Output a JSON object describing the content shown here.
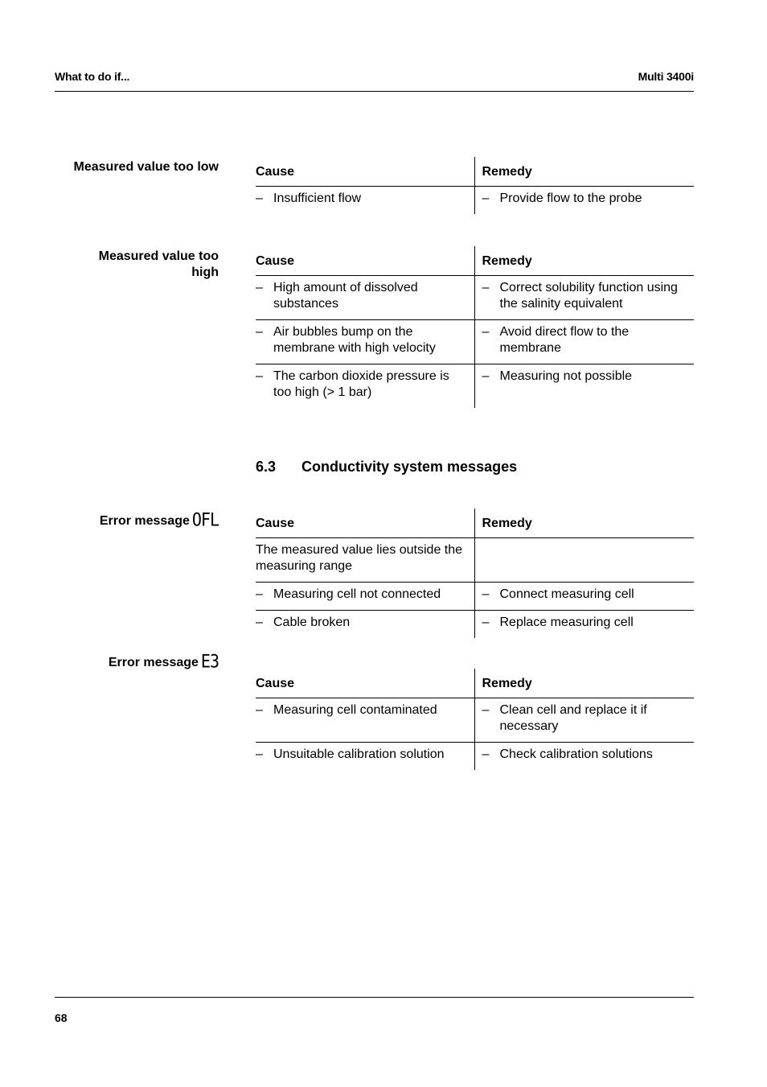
{
  "header": {
    "chapter": "What to do if...",
    "product": "Multi 3400i"
  },
  "sections": [
    {
      "label": "Measured value too low",
      "table": {
        "columns": [
          "Cause",
          "Remedy"
        ],
        "rows": [
          {
            "cause": "Insufficient flow",
            "cause_bullet": "–",
            "remedy": "Provide flow to the probe",
            "remedy_bullet": "–"
          }
        ]
      }
    },
    {
      "label_line1": "Measured value too",
      "label_line2": "high",
      "table": {
        "columns": [
          "Cause",
          "Remedy"
        ],
        "rows": [
          {
            "cause": "High amount of dissolved substances",
            "cause_bullet": "–",
            "remedy": "Correct solubility function using the salinity equivalent",
            "remedy_bullet": "–"
          },
          {
            "cause": "Air bubbles bump on the membrane with high velocity",
            "cause_bullet": "–",
            "remedy": "Avoid direct flow to the membrane",
            "remedy_bullet": "–"
          },
          {
            "cause": "The carbon dioxide pressure is too high (> 1 bar)",
            "cause_bullet": "–",
            "remedy": "Measuring not possible",
            "remedy_bullet": "–"
          }
        ]
      }
    },
    {
      "section_number": "6.3",
      "section_title": "Conductivity system messages"
    },
    {
      "label": "Error message",
      "code": "OFL",
      "table": {
        "columns": [
          "Cause",
          "Remedy"
        ],
        "intro": "The measured value lies outside the measuring range",
        "rows": [
          {
            "cause": "Measuring cell not connected",
            "cause_bullet": "–",
            "remedy": "Connect measuring cell",
            "remedy_bullet": "–"
          },
          {
            "cause": "Cable broken",
            "cause_bullet": "–",
            "remedy": "Replace measuring cell",
            "remedy_bullet": "–"
          }
        ]
      }
    },
    {
      "label": "Error message",
      "code": "E3",
      "table": {
        "columns": [
          "Cause",
          "Remedy"
        ],
        "rows": [
          {
            "cause": "Measuring cell contaminated",
            "cause_bullet": "–",
            "remedy": "Clean cell and replace it if necessary",
            "remedy_bullet": "–"
          },
          {
            "cause": "Unsuitable calibration solution",
            "cause_bullet": "–",
            "remedy": "Check calibration solutions",
            "remedy_bullet": "–"
          }
        ]
      }
    }
  ],
  "footer": {
    "page_number": "68"
  }
}
